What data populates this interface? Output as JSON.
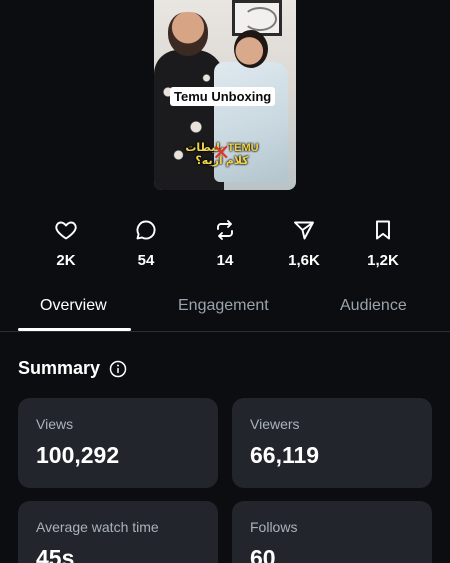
{
  "video": {
    "caption": "Temu Unboxing",
    "overlay_text": "TEMU بلیطات كلام اريه؟"
  },
  "stats": [
    {
      "icon": "heart-icon",
      "value": "2K"
    },
    {
      "icon": "comment-icon",
      "value": "54"
    },
    {
      "icon": "repost-icon",
      "value": "14"
    },
    {
      "icon": "share-icon",
      "value": "1,6K"
    },
    {
      "icon": "bookmark-icon",
      "value": "1,2K"
    }
  ],
  "tabs": [
    {
      "label": "Overview",
      "active": true
    },
    {
      "label": "Engagement",
      "active": false
    },
    {
      "label": "Audience",
      "active": false
    }
  ],
  "summary": {
    "title": "Summary",
    "info_icon": "info-icon",
    "cards": [
      {
        "label": "Views",
        "value": "100,292"
      },
      {
        "label": "Viewers",
        "value": "66,119"
      },
      {
        "label": "Average watch time",
        "value": "45s"
      },
      {
        "label": "Follows",
        "value": "60"
      }
    ]
  },
  "colors": {
    "background": "#0b0d10",
    "card": "#22262c",
    "text": "#ffffff",
    "muted": "#9aa3ad",
    "divider": "#2a2f36"
  }
}
